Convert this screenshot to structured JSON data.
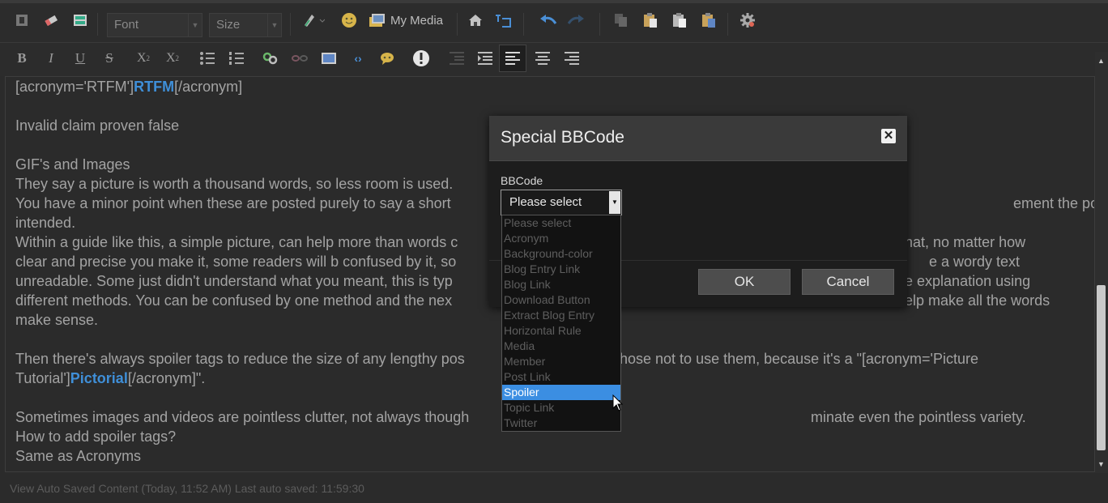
{
  "toolbar1": {
    "font_placeholder": "Font",
    "size_placeholder": "Size",
    "my_media_label": "My Media"
  },
  "editor_lines": [
    {
      "parts": [
        {
          "t": "[acronym='RTFM']"
        },
        {
          "t": "RTFM",
          "blue": true
        },
        {
          "t": "[/acronym]"
        }
      ]
    },
    {
      "parts": [
        {
          "t": "Invalid claim proven false"
        }
      ]
    },
    {
      "parts": [
        {
          "t": "GIF's and Images"
        }
      ]
    },
    {
      "parts": [
        {
          "t": "They say a picture is worth a thousand words, so less room is used."
        }
      ]
    },
    {
      "parts": [
        {
          "t": "You have a minor point when these are posted purely to say a short"
        }
      ],
      "right": "ement the poster"
    },
    {
      "parts": [
        {
          "t": "intended."
        }
      ]
    },
    {
      "parts": [
        {
          "t": "Within a guide like this, a simple picture, can help more than words c"
        }
      ],
      "right": "u that, no matter how"
    },
    {
      "parts": [
        {
          "t": "clear and precise you make it, some readers will b confused by it, so"
        }
      ],
      "right": "e a wordy text"
    },
    {
      "parts": [
        {
          "t": "unreadable. Some just didn't understand what you meant, this is typ"
        }
      ],
      "right": "he explanation using"
    },
    {
      "parts": [
        {
          "t": "different methods. You can be confused by one method and the nex"
        }
      ],
      "right": "help make all the words"
    },
    {
      "parts": [
        {
          "t": "make sense."
        }
      ]
    },
    {
      "parts": [
        {
          "t": "Then there's always spoiler tags to reduce the size of any lengthy pos"
        }
      ],
      "right": "hose not to use them, because it's a \"[acronym='Picture"
    },
    {
      "parts": [
        {
          "t": "Tutorial']"
        },
        {
          "t": "Pictorial",
          "blue": true
        },
        {
          "t": "[/acronym]\"."
        }
      ]
    },
    {
      "parts": [
        {
          "t": "Sometimes images and videos are pointless clutter, not always though"
        }
      ],
      "right": "minate even the pointless variety."
    },
    {
      "parts": [
        {
          "t": "How to add spoiler tags?"
        }
      ]
    },
    {
      "parts": [
        {
          "t": "Same as Acronyms"
        }
      ]
    }
  ],
  "status_bar": {
    "text": "View Auto Saved Content (Today, 11:52 AM)  Last auto saved: 11:59:30"
  },
  "modal": {
    "title": "Special BBCode",
    "field_label": "BBCode",
    "select_value": "Please select",
    "ok_label": "OK",
    "cancel_label": "Cancel",
    "options": [
      "Please select",
      "Acronym",
      "Background-color",
      "Blog Entry Link",
      "Blog Link",
      "Download Button",
      "Extract Blog Entry",
      "Horizontal Rule",
      "Media",
      "Member",
      "Post Link",
      "Spoiler",
      "Topic Link",
      "Twitter"
    ],
    "selected_option": "Spoiler"
  },
  "colors": {
    "accent_blue": "#3f8fd8",
    "selection_blue": "#3b8ee2"
  }
}
